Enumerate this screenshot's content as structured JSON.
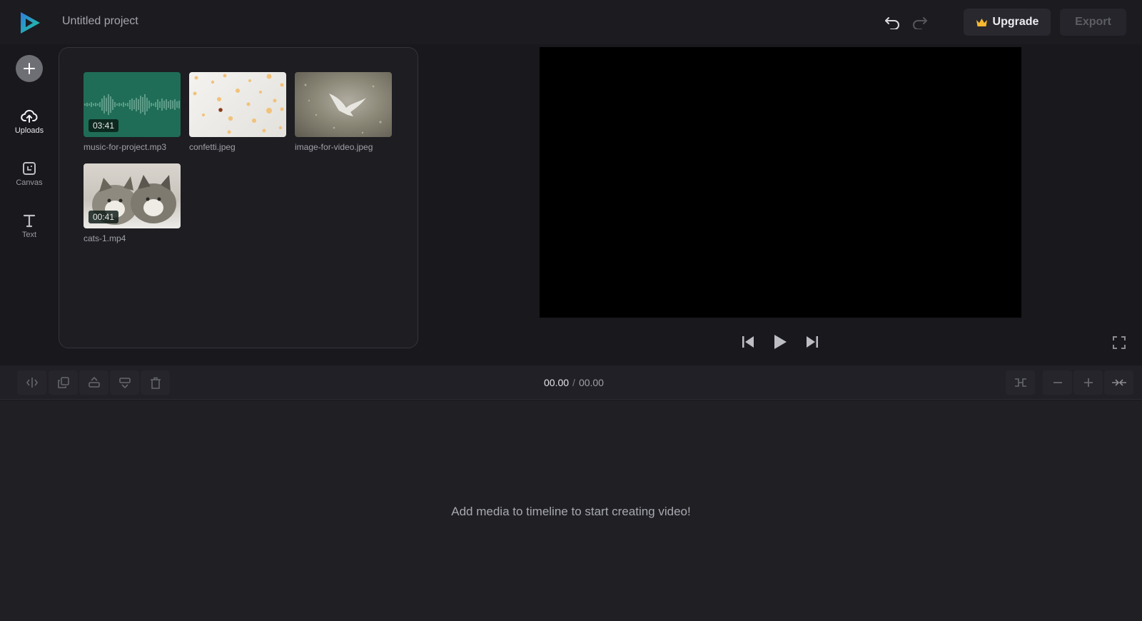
{
  "header": {
    "project_title": "Untitled project",
    "undo_icon": "undo-icon",
    "redo_icon": "redo-icon",
    "upgrade_label": "Upgrade",
    "upgrade_icon": "crown-icon",
    "export_label": "Export"
  },
  "sidebar": {
    "add_icon": "plus-icon",
    "items": [
      {
        "label": "Uploads",
        "icon": "cloud-upload-icon",
        "active": true
      },
      {
        "label": "Canvas",
        "icon": "canvas-resize-icon",
        "active": false
      },
      {
        "label": "Text",
        "icon": "text-t-icon",
        "active": false
      }
    ]
  },
  "media": {
    "items": [
      {
        "name": "music-for-project.mp3",
        "type": "audio",
        "duration": "03:41"
      },
      {
        "name": "confetti.jpeg",
        "type": "image"
      },
      {
        "name": "image-for-video.jpeg",
        "type": "image"
      },
      {
        "name": "cats-1.mp4",
        "type": "video",
        "duration": "00:41"
      }
    ]
  },
  "player": {
    "controls": [
      "skip-back-icon",
      "play-icon",
      "skip-forward-icon"
    ],
    "fullscreen_icon": "fullscreen-icon"
  },
  "toolbar": {
    "tools": [
      "split-icon",
      "duplicate-icon",
      "move-up-icon",
      "move-down-icon",
      "delete-icon"
    ],
    "time_current": "00.00",
    "time_separator": "/",
    "time_total": "00.00",
    "zoom_tools": [
      "fit-icon",
      "zoom-out-icon",
      "zoom-in-icon",
      "collapse-icon"
    ]
  },
  "timeline": {
    "empty_message": "Add media to timeline to start creating video!"
  },
  "colors": {
    "background": "#18181d",
    "preview": "#000000",
    "audio_thumb": "#1f6d56",
    "logo_blue": "#2f7de1",
    "logo_green": "#20c997",
    "crown": "#f5b82e"
  }
}
